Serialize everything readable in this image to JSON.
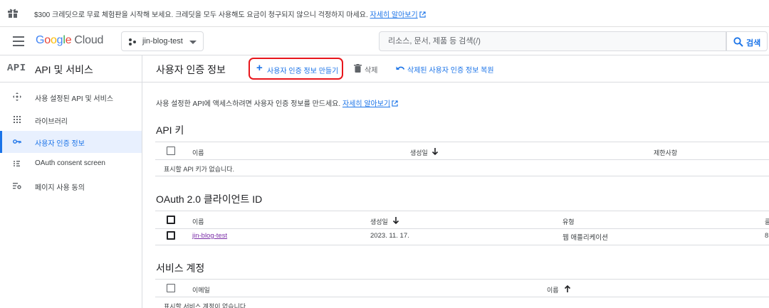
{
  "banner": {
    "message": "$300 크레딧으로 무료 체험판을 시작해 보세요. 크레딧을 모두 사용해도 요금이 청구되지 않으니 걱정하지 마세요.",
    "link": "자세히 알아보기"
  },
  "header": {
    "logo_letters": [
      "G",
      "o",
      "o",
      "g",
      "l",
      "e"
    ],
    "logo_product": "Cloud",
    "project": "jin-blog-test",
    "search_placeholder": "리소스, 문서, 제품 등 검색(/)",
    "search_button": "검색"
  },
  "sidebar": {
    "logo": "API",
    "title": "API 및 서비스",
    "items": [
      {
        "label": "사용 설정된 API 및 서비스",
        "icon": "diamond-arrows-icon"
      },
      {
        "label": "라이브러리",
        "icon": "grid-icon"
      },
      {
        "label": "사용자 인증 정보",
        "icon": "key-icon",
        "active": true
      },
      {
        "label": "OAuth consent screen",
        "icon": "consent-dots-icon"
      },
      {
        "label": "페이지 사용 동의",
        "icon": "settings-list-icon"
      }
    ]
  },
  "toolbar": {
    "title": "사용자 인증 정보",
    "create": "사용자 인증 정보 만들기",
    "delete": "삭제",
    "restore": "삭제된 사용자 인증 정보 복원"
  },
  "intro": {
    "text": "사용 설정한 API에 액세스하려면 사용자 인증 정보를 만드세요.",
    "link": "자세히 알아보기"
  },
  "api_keys": {
    "title": "API 키",
    "columns": [
      "이름",
      "생성일",
      "제한사항"
    ],
    "empty": "표시할 API 키가 없습니다."
  },
  "oauth": {
    "title": "OAuth 2.0 클라이언트 ID",
    "columns": [
      "이름",
      "생성일",
      "유형",
      "클"
    ],
    "rows": [
      {
        "name": "jin-blog-test",
        "created": "2023. 11. 17.",
        "type": "웹 애플리케이션",
        "extra": "8"
      }
    ]
  },
  "service_accounts": {
    "title": "서비스 계정",
    "columns": [
      "이메일",
      "이름"
    ],
    "empty": "표시할 서비스 계정이 없습니다."
  },
  "colors": {
    "accent": "#1a73e8",
    "highlight": "#e8161c",
    "visited_link": "#7b2ea8"
  }
}
